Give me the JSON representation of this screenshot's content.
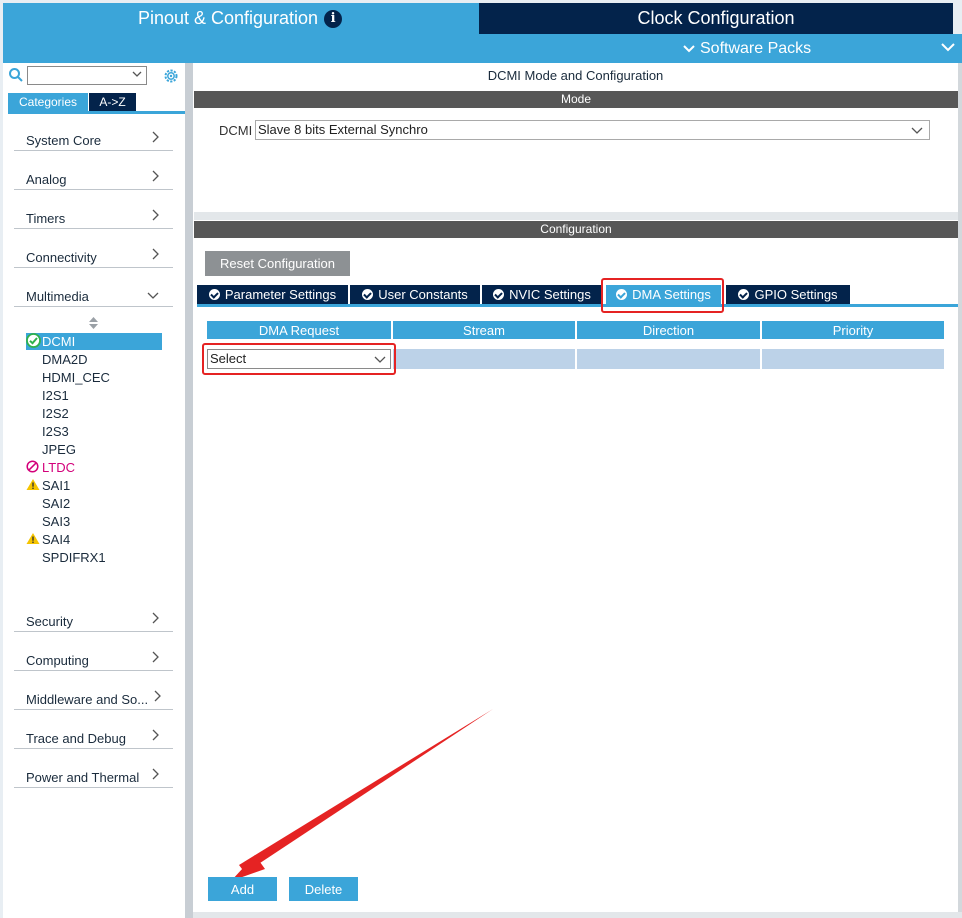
{
  "header": {
    "tab_pinout": "Pinout & Configuration",
    "tab_clock": "Clock Configuration",
    "software_packs": "Software Packs"
  },
  "sidebar": {
    "tabs": [
      "Categories",
      "A->Z"
    ],
    "categories": [
      {
        "label": "System Core"
      },
      {
        "label": "Analog"
      },
      {
        "label": "Timers"
      },
      {
        "label": "Connectivity"
      },
      {
        "label": "Multimedia"
      },
      {
        "label": "Security"
      },
      {
        "label": "Computing"
      },
      {
        "label": "Middleware and So..."
      },
      {
        "label": "Trace and Debug"
      },
      {
        "label": "Power and Thermal"
      }
    ],
    "multimedia_items": [
      {
        "label": "DCMI",
        "status": "ok"
      },
      {
        "label": "DMA2D",
        "status": "none"
      },
      {
        "label": "HDMI_CEC",
        "status": "none"
      },
      {
        "label": "I2S1",
        "status": "none"
      },
      {
        "label": "I2S2",
        "status": "none"
      },
      {
        "label": "I2S3",
        "status": "none"
      },
      {
        "label": "JPEG",
        "status": "none"
      },
      {
        "label": "LTDC",
        "status": "disabled"
      },
      {
        "label": "SAI1",
        "status": "warning"
      },
      {
        "label": "SAI2",
        "status": "none"
      },
      {
        "label": "SAI3",
        "status": "none"
      },
      {
        "label": "SAI4",
        "status": "warning"
      },
      {
        "label": "SPDIFRX1",
        "status": "none"
      }
    ]
  },
  "main": {
    "title": "DCMI Mode and Configuration",
    "mode_header": "Mode",
    "dcmi_label": "DCMI",
    "dcmi_value": "Slave 8 bits External Synchro",
    "config_header": "Configuration",
    "reset_button": "Reset Configuration",
    "config_tabs": [
      "Parameter Settings",
      "User Constants",
      "NVIC Settings",
      "DMA Settings",
      "GPIO Settings"
    ],
    "active_tab": "DMA Settings",
    "dma_table": {
      "columns": [
        "DMA Request",
        "Stream",
        "Direction",
        "Priority"
      ],
      "row_select": "Select"
    },
    "add_button": "Add",
    "delete_button": "Delete"
  },
  "colors": {
    "accent": "#3ba5d9",
    "dark": "#03234b",
    "highlight": "#e52323",
    "ok": "#2fb14b",
    "disabled": "#d3007a",
    "warning": "#f5c400"
  }
}
